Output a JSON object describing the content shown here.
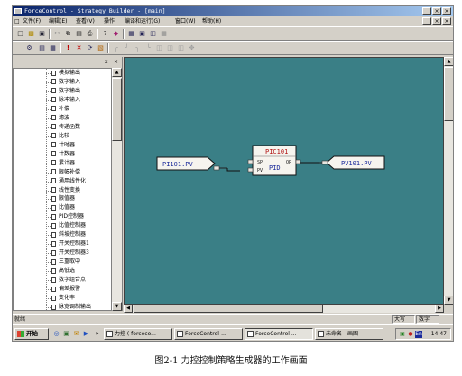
{
  "window": {
    "title": "ForceControl - Strategy Builder - [main]",
    "title_buttons": [
      "_",
      "×",
      "×"
    ],
    "mdi_buttons": [
      "_",
      "×",
      "×"
    ]
  },
  "menu": [
    {
      "label": "文件(F)"
    },
    {
      "label": "编辑(E)"
    },
    {
      "label": "查看(V)"
    },
    {
      "label": "操作"
    },
    {
      "label": "编译和运行(G)"
    },
    {
      "label": "窗口(W)"
    },
    {
      "label": "帮助(H)"
    }
  ],
  "panel": {
    "buttons": [
      "x",
      "×"
    ],
    "tree_items": [
      "模拟输出",
      "数字输入",
      "数字输出",
      "脉冲输入",
      "补偿",
      "滤波",
      "传递函数",
      "比较",
      "计时器",
      "计数器",
      "累计器",
      "限幅补偿",
      "通用线性化",
      "线性变换",
      "限值器",
      "比值器",
      "PID控制器",
      "比值控制器",
      "斜坡控制器",
      "开关控制器1",
      "开关控制器3",
      "三重取中",
      "高低选",
      "数字组合点",
      "偏差报警",
      "变化率",
      "脉宽调制输出"
    ]
  },
  "diagram": {
    "input_tag": "PI101.PV",
    "output_tag": "PV101.PV",
    "block_name": "PIC101",
    "block_type": "PID",
    "in_ports": [
      "SP",
      "PV"
    ],
    "out_port": "OP",
    "colors": {
      "canvas": "#3a7f86",
      "tag_text": "#1a2a9a",
      "block_title": "#b01010"
    }
  },
  "status": {
    "ready": "就绪",
    "caps": "大写",
    "num": "数字"
  },
  "taskbar": {
    "start": "开始",
    "tasks": [
      "力控 ( forceco...",
      "ForceControl-...",
      "ForceControl ...",
      "未命名 - 画图"
    ],
    "tray_lang": "En",
    "clock": "14:47"
  },
  "caption": "图2-1 力控控制策略生成器的工作画面"
}
